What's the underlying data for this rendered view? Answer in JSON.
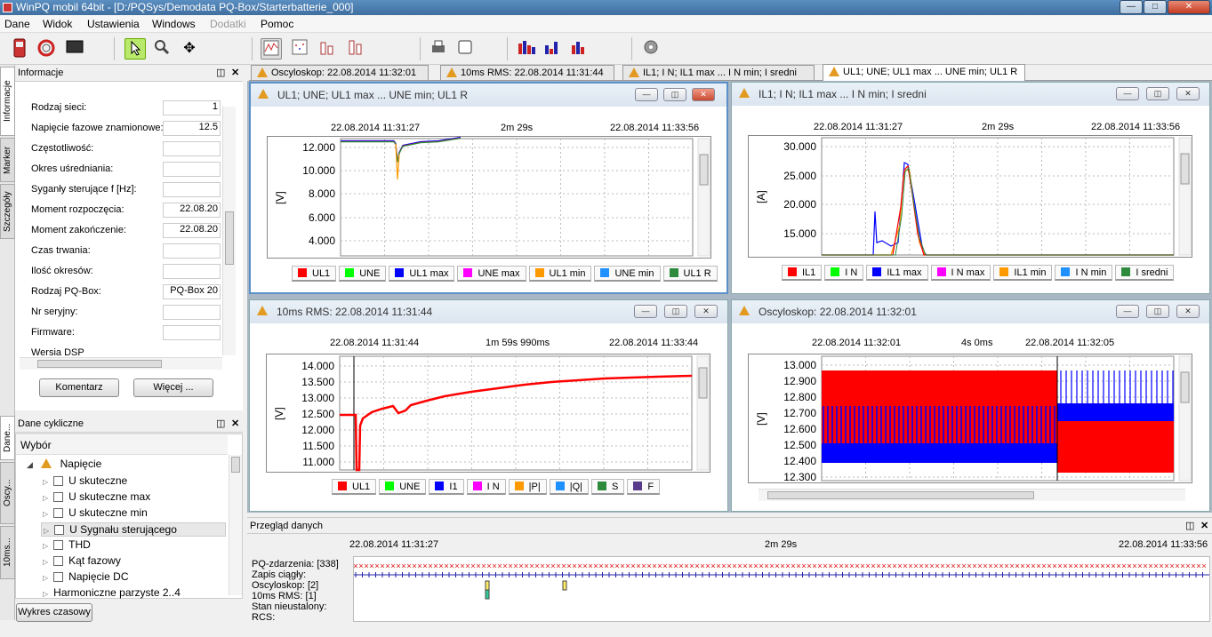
{
  "app": {
    "title": "WinPQ mobil 64bit - [D:/PQSys/Demodata PQ-Box/Starterbatterie_000]"
  },
  "menu": [
    "Dane",
    "Widok",
    "Ustawienia",
    "Windows",
    "Dodatki",
    "Pomoc"
  ],
  "side_tabs": [
    "Informacje",
    "Marker",
    "Szczegóły",
    "Dane...",
    "Oscy...",
    "10ms..."
  ],
  "info_panel": {
    "title": "Informacje",
    "fields": [
      {
        "label": "Rodzaj sieci:",
        "value": "1"
      },
      {
        "label": "Napięcie fazowe znamionowe:",
        "value": "12.5"
      },
      {
        "label": "Częstotliwość:",
        "value": ""
      },
      {
        "label": "Okres uśredniania:",
        "value": ""
      },
      {
        "label": "Syganły sterujące f [Hz]:",
        "value": ""
      },
      {
        "label": "Moment rozpoczęcia:",
        "value": "22.08.20"
      },
      {
        "label": "Moment zakończenie:",
        "value": "22.08.20"
      },
      {
        "label": "Czas trwania:",
        "value": ""
      },
      {
        "label": "Ilość okresów:",
        "value": ""
      },
      {
        "label": "Rodzaj PQ-Box:",
        "value": "PQ-Box 20"
      },
      {
        "label": "Nr seryjny:",
        "value": ""
      },
      {
        "label": "Firmware:",
        "value": ""
      },
      {
        "label": "Wersia DSP",
        "value": ""
      }
    ],
    "comment_button": "Komentarz",
    "more_button": "Więcej ..."
  },
  "cyclic_panel": {
    "title": "Dane cykliczne",
    "header": "Wybór",
    "root": "Napięcie",
    "items": [
      "U skuteczne",
      "U skuteczne max",
      "U skuteczne min",
      "U Sygnału sterującego",
      "THD",
      "Kąt fazowy",
      "Napięcie DC",
      "Harmoniczne parzyste 2..4"
    ],
    "timeline_button": "Wykres czasowy"
  },
  "doc_tabs": [
    "Oscyloskop: 22.08.2014 11:32:01",
    "10ms RMS: 22.08.2014 11:31:44",
    "IL1; I N; IL1 max  ...  I N min; I sredni",
    "UL1; UNE; UL1 max  ...  UNE min; UL1 R"
  ],
  "windows": [
    {
      "title": "UL1; UNE; UL1 max  ...  UNE min; UL1 R",
      "t_start": "22.08.2014 11:31:27",
      "duration": "2m 29s",
      "t_end": "22.08.2014 11:33:56",
      "ylabel": "[V]",
      "yticks": [
        "12.000",
        "10.000",
        "8.000",
        "6.000",
        "4.000"
      ],
      "legend": [
        {
          "name": "UL1",
          "color": "#ff0000"
        },
        {
          "name": "UNE",
          "color": "#00ff00"
        },
        {
          "name": "UL1 max",
          "color": "#0000ff"
        },
        {
          "name": "UNE max",
          "color": "#ff00ff"
        },
        {
          "name": "UL1 min",
          "color": "#ff9900"
        },
        {
          "name": "UNE min",
          "color": "#1e90ff"
        },
        {
          "name": "UL1 R",
          "color": "#2e8b3e"
        }
      ]
    },
    {
      "title": "IL1; I N; IL1 max  ...  I N min; I sredni",
      "t_start": "22.08.2014 11:31:27",
      "duration": "2m 29s",
      "t_end": "22.08.2014 11:33:56",
      "ylabel": "[A]",
      "yticks": [
        "30.000",
        "25.000",
        "20.000",
        "15.000"
      ],
      "legend": [
        {
          "name": "IL1",
          "color": "#ff0000"
        },
        {
          "name": "I N",
          "color": "#00ff00"
        },
        {
          "name": "IL1 max",
          "color": "#0000ff"
        },
        {
          "name": "I N max",
          "color": "#ff00ff"
        },
        {
          "name": "IL1 min",
          "color": "#ff9900"
        },
        {
          "name": "I N min",
          "color": "#1e90ff"
        },
        {
          "name": "I sredni",
          "color": "#2e8b3e"
        }
      ]
    },
    {
      "title": "10ms RMS: 22.08.2014 11:31:44",
      "t_start": "22.08.2014 11:31:44",
      "duration": "1m 59s 990ms",
      "t_end": "22.08.2014 11:33:44",
      "ylabel": "[V]",
      "yticks": [
        "14.000",
        "13.500",
        "13.000",
        "12.500",
        "12.000",
        "11.500",
        "11.000"
      ],
      "legend": [
        {
          "name": "UL1",
          "color": "#ff0000"
        },
        {
          "name": "UNE",
          "color": "#00ff00"
        },
        {
          "name": "I1",
          "color": "#0000ff"
        },
        {
          "name": "I N",
          "color": "#ff00ff"
        },
        {
          "name": "|P|",
          "color": "#ff9900"
        },
        {
          "name": "|Q|",
          "color": "#1e90ff"
        },
        {
          "name": "S",
          "color": "#2e8b3e"
        },
        {
          "name": "F",
          "color": "#5a3a8a"
        }
      ]
    },
    {
      "title": "Oscyloskop: 22.08.2014 11:32:01",
      "t_start": "22.08.2014 11:32:01",
      "duration": "4s 0ms",
      "t_end": "22.08.2014 11:32:05",
      "ylabel": "[V]",
      "yticks": [
        "13.000",
        "12.900",
        "12.800",
        "12.700",
        "12.600",
        "12.500",
        "12.400",
        "12.300"
      ]
    }
  ],
  "overview": {
    "title": "Przegląd danych",
    "t_start": "22.08.2014 11:31:27",
    "duration": "2m 29s",
    "t_end": "22.08.2014 11:33:56",
    "rows": [
      "PQ-zdarzenia: [338]",
      "Zapis ciągły:",
      "Oscyloskop: [2]",
      "10ms RMS: [1]",
      "Stan nieustalony:",
      "RCS:"
    ]
  }
}
